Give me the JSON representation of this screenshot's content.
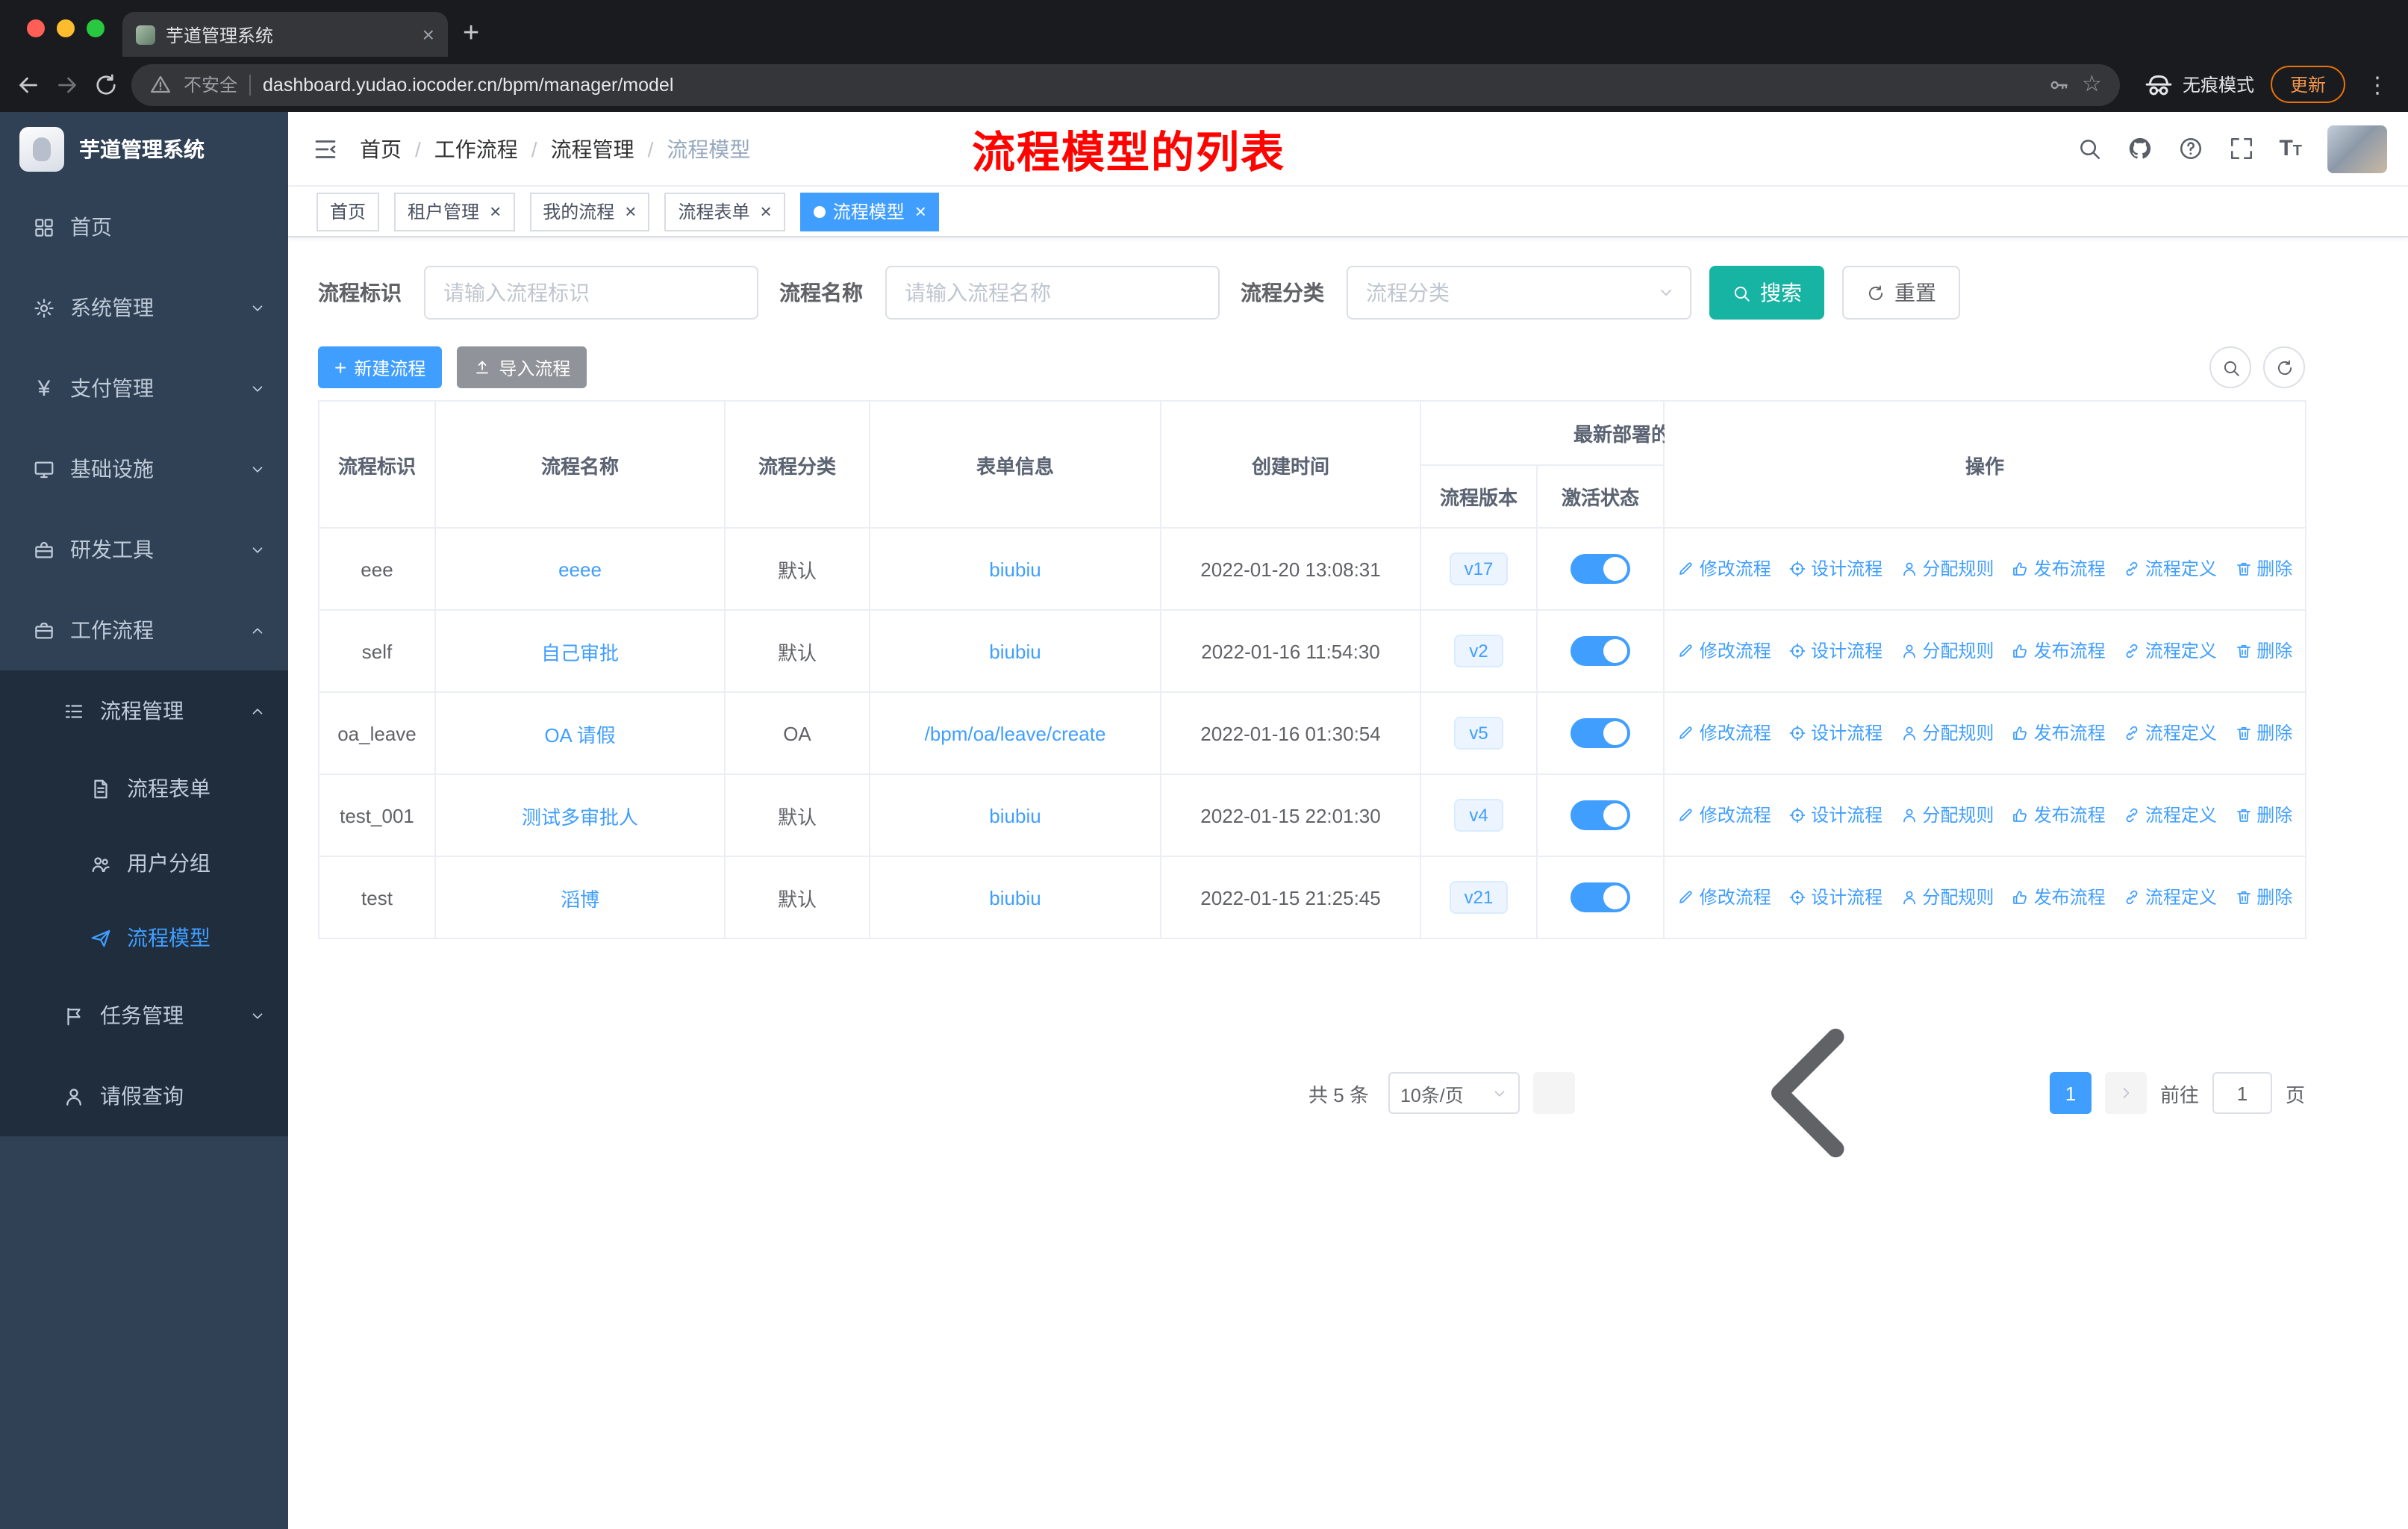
{
  "colors": {
    "primary": "#409eff",
    "search_button": "#17b3a3",
    "annotation_red": "#fe0400",
    "sidebar_bg": "#304156",
    "sidebar_sub_bg": "#1f2d3d",
    "toggle_on": "#409eff",
    "tag_active_bg": "#409eff",
    "badge_bg": "#ecf5ff",
    "update_button_orange": "#e8710a"
  },
  "glyphs": {
    "close": "×",
    "plus": "+",
    "kebab": "⋮",
    "star": "☆",
    "yen": "¥",
    "font_big": "T",
    "font_small": "T"
  },
  "browser": {
    "tab_title": "芋道管理系统",
    "security_label": "不安全",
    "url": "dashboard.yudao.iocoder.cn/bpm/manager/model",
    "incognito_label": "无痕模式",
    "update_label": "更新"
  },
  "sidebar": {
    "logo_title": "芋道管理系统",
    "items": [
      {
        "label": "首页"
      },
      {
        "label": "系统管理",
        "chevron": "down"
      },
      {
        "label": "支付管理",
        "chevron": "down"
      },
      {
        "label": "基础设施",
        "chevron": "down"
      },
      {
        "label": "研发工具",
        "chevron": "down"
      },
      {
        "label": "工作流程",
        "chevron": "up",
        "expanded": true
      },
      {
        "label": "流程管理",
        "chevron": "up",
        "expanded": true
      },
      {
        "label": "流程表单"
      },
      {
        "label": "用户分组"
      },
      {
        "label": "流程模型",
        "active": true
      },
      {
        "label": "任务管理",
        "chevron": "down"
      },
      {
        "label": "请假查询"
      }
    ]
  },
  "navbar": {
    "breadcrumb": [
      "首页",
      "工作流程",
      "流程管理",
      "流程模型"
    ],
    "separator": "/",
    "annotation": "流程模型的列表"
  },
  "tabs": [
    {
      "label": "首页",
      "closable": false
    },
    {
      "label": "租户管理",
      "closable": true
    },
    {
      "label": "我的流程",
      "closable": true
    },
    {
      "label": "流程表单",
      "closable": true
    },
    {
      "label": "流程模型",
      "closable": true,
      "active": true
    }
  ],
  "filters": {
    "id_label": "流程标识",
    "id_placeholder": "请输入流程标识",
    "name_label": "流程名称",
    "name_placeholder": "请输入流程名称",
    "category_label": "流程分类",
    "category_placeholder": "流程分类",
    "search_label": "搜索",
    "reset_label": "重置"
  },
  "toolbar": {
    "create_label": "新建流程",
    "import_label": "导入流程"
  },
  "table": {
    "headers": {
      "id": "流程标识",
      "name": "流程名称",
      "category": "流程分类",
      "form": "表单信息",
      "created": "创建时间",
      "deploy_group": "最新部署的",
      "version": "流程版本",
      "state": "激活状态",
      "actions": "操作"
    },
    "rows": [
      {
        "id": "eee",
        "name": "eeee",
        "category": "默认",
        "form": "biubiu",
        "created": "2022-01-20 13:08:31",
        "version": "v17",
        "active": true
      },
      {
        "id": "self",
        "name": "自己审批",
        "category": "默认",
        "form": "biubiu",
        "created": "2022-01-16 11:54:30",
        "version": "v2",
        "active": true
      },
      {
        "id": "oa_leave",
        "name": "OA 请假",
        "category": "OA",
        "form": "/bpm/oa/leave/create",
        "created": "2022-01-16 01:30:54",
        "version": "v5",
        "active": true
      },
      {
        "id": "test_001",
        "name": "测试多审批人",
        "category": "默认",
        "form": "biubiu",
        "created": "2022-01-15 22:01:30",
        "version": "v4",
        "active": true
      },
      {
        "id": "test",
        "name": "滔博",
        "category": "默认",
        "form": "biubiu",
        "created": "2022-01-15 21:25:45",
        "version": "v21",
        "active": true
      }
    ],
    "row_actions": [
      "修改流程",
      "设计流程",
      "分配规则",
      "发布流程",
      "流程定义",
      "删除"
    ]
  },
  "pagination": {
    "total": "共 5 条",
    "page_size": "10条/页",
    "current_page": "1",
    "goto_label": "前往",
    "goto_value": "1",
    "page_label": "页"
  }
}
